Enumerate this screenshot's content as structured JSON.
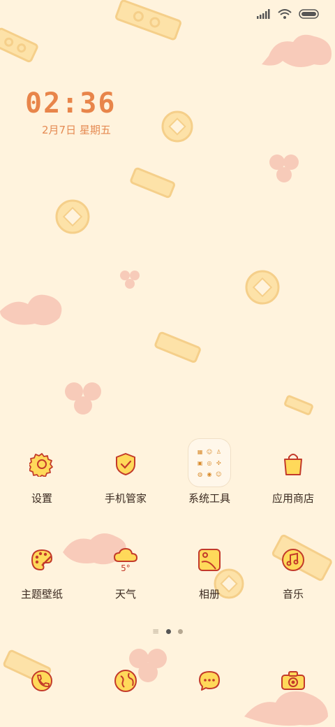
{
  "status_bar": {
    "signal": "signal-icon",
    "wifi": "wifi-icon",
    "battery": "battery-icon"
  },
  "clock": {
    "time": "02:36",
    "date": "2月7日 星期五"
  },
  "apps_row1": [
    {
      "label": "设置",
      "icon": "settings-gear-icon"
    },
    {
      "label": "手机管家",
      "icon": "shield-check-icon"
    },
    {
      "label": "系统工具",
      "icon": "folder-icon"
    },
    {
      "label": "应用商店",
      "icon": "shopping-bag-icon"
    }
  ],
  "apps_row2": [
    {
      "label": "主题壁纸",
      "icon": "palette-brush-icon"
    },
    {
      "label": "天气",
      "icon": "cloud-weather-icon",
      "temp": "5°"
    },
    {
      "label": "相册",
      "icon": "gallery-icon"
    },
    {
      "label": "音乐",
      "icon": "music-note-icon"
    }
  ],
  "dock": [
    {
      "icon": "phone-icon"
    },
    {
      "icon": "browser-globe-icon"
    },
    {
      "icon": "message-bubble-icon"
    },
    {
      "icon": "camera-icon"
    }
  ],
  "colors": {
    "background": "#fff3dd",
    "accent": "#e8854a",
    "icon_fill": "#ffd95a",
    "icon_stroke": "#c33a2a"
  }
}
